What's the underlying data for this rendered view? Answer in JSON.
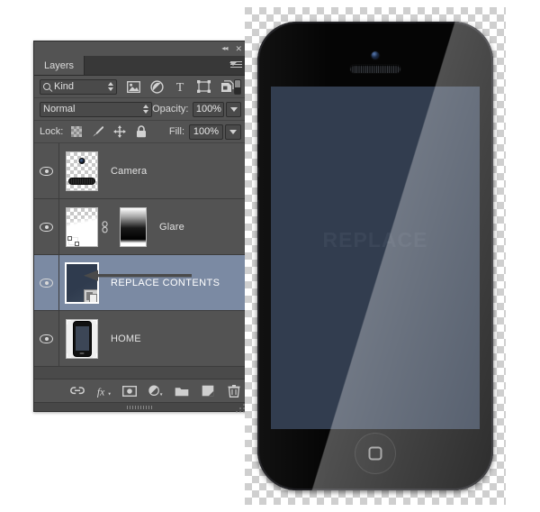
{
  "panel": {
    "tab_label": "Layers",
    "collapse_icon": "double-left-arrow-icon",
    "close_icon": "close-icon",
    "menu_icon": "panel-menu-icon",
    "filter": {
      "kind_label": "Kind",
      "search_icon": "search-icon",
      "icons": [
        "pixel-layer-filter-icon",
        "adjustment-layer-filter-icon",
        "type-layer-filter-icon",
        "shape-layer-filter-icon",
        "smart-object-filter-icon"
      ],
      "toggle_name": "filter-enable-toggle"
    },
    "blend": {
      "mode": "Normal",
      "opacity_label": "Opacity:",
      "opacity_value": "100%",
      "fill_label": "Fill:",
      "fill_value": "100%"
    },
    "lock": {
      "label": "Lock:",
      "icons": [
        "lock-transparency-icon",
        "lock-image-icon",
        "lock-position-icon",
        "lock-all-icon"
      ]
    },
    "layers": [
      {
        "name": "Camera",
        "visible": true,
        "selected": false,
        "kind": "pixel"
      },
      {
        "name": "Glare",
        "visible": true,
        "selected": false,
        "kind": "masked",
        "has_mask": true,
        "has_link": true
      },
      {
        "name": "REPLACE CONTENTS",
        "visible": true,
        "selected": true,
        "kind": "smart-object"
      },
      {
        "name": "HOME",
        "visible": true,
        "selected": false,
        "kind": "pixel"
      }
    ],
    "bottom_icons": [
      "link-layers-icon",
      "layer-style-fx-icon",
      "add-layer-mask-icon",
      "new-adjustment-layer-icon",
      "new-group-icon",
      "new-layer-icon",
      "delete-layer-icon"
    ]
  },
  "canvas": {
    "screen_text": "Replace",
    "device_name": "phone-mockup"
  },
  "colors": {
    "panel_bg": "#535353",
    "panel_dark": "#383838",
    "selected_row": "#7b8aa3",
    "screen_bg": "#323d4f",
    "text": "#e2e2e2"
  }
}
